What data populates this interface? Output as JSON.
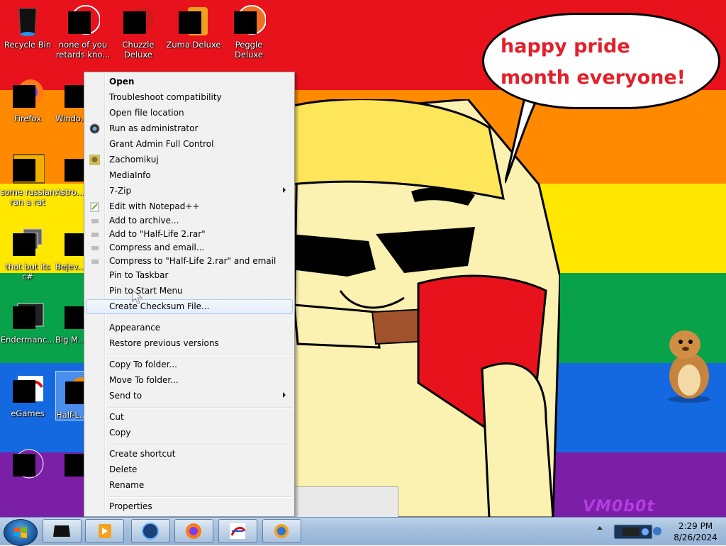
{
  "wallpaper": {
    "stripes": [
      "#e8121c",
      "#ff8a00",
      "#ffe700",
      "#07a24a",
      "#1569e0",
      "#7a1fa6"
    ],
    "speech_text": "happy pride month everyone!",
    "watermark": "VM0b0t"
  },
  "desktop_icons": [
    {
      "label": "Recycle Bin"
    },
    {
      "label": "none of you retards kno..."
    },
    {
      "label": "Chuzzle Deluxe"
    },
    {
      "label": "Zuma Deluxe"
    },
    {
      "label": "Peggle Deluxe"
    },
    {
      "label": "Firefox"
    },
    {
      "label": "Windo... M..."
    },
    {
      "label": "some russian ran a rat"
    },
    {
      "label": "Astro... Delu..."
    },
    {
      "label": "that but its c#"
    },
    {
      "label": "Bejev... Delu..."
    },
    {
      "label": "Endermanc..."
    },
    {
      "label": "Big M... Delu..."
    },
    {
      "label": "eGames"
    },
    {
      "label": "Half-L..."
    },
    {
      "label": ""
    },
    {
      "label": ""
    }
  ],
  "context_menu": {
    "items": [
      {
        "label": "Open"
      },
      {
        "label": "Troubleshoot compatibility"
      },
      {
        "label": "Open file location"
      },
      {
        "label": "Run as administrator"
      },
      {
        "label": "Grant Admin Full Control"
      },
      {
        "label": "Zachomikuj"
      },
      {
        "label": "MediaInfo"
      },
      {
        "label": "7-Zip"
      },
      {
        "label": "Edit with Notepad++"
      },
      {
        "label": "Add to archive..."
      },
      {
        "label": "Add to \"Half-Life 2.rar\""
      },
      {
        "label": "Compress and email..."
      },
      {
        "label": "Compress to \"Half-Life 2.rar\" and email"
      },
      {
        "label": "Pin to Taskbar"
      },
      {
        "label": "Pin to Start Menu"
      },
      {
        "label": "Create Checksum File..."
      },
      {
        "label": "Appearance"
      },
      {
        "label": "Restore previous versions"
      },
      {
        "label": "Copy To folder..."
      },
      {
        "label": "Move To folder..."
      },
      {
        "label": "Send to"
      },
      {
        "label": "Cut"
      },
      {
        "label": "Copy"
      },
      {
        "label": "Create shortcut"
      },
      {
        "label": "Delete"
      },
      {
        "label": "Rename"
      },
      {
        "label": "Properties"
      }
    ]
  },
  "taskbar": {
    "apps": [
      "dark-app-icon",
      "media-player-icon",
      "globe-icon",
      "firefox-icon",
      "egames-icon",
      "internet-icon"
    ],
    "clock": {
      "time": "2:29 PM",
      "date": "8/26/2024"
    }
  }
}
